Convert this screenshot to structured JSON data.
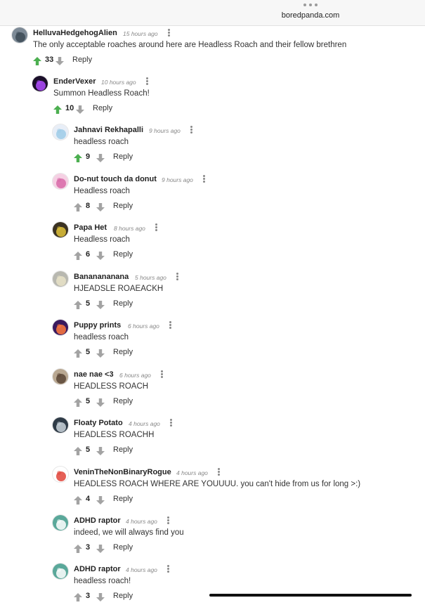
{
  "browser": {
    "url": "boredpanda.com"
  },
  "comments": [
    {
      "author": "HelluvaHedgehogAlien",
      "time": "15 hours ago",
      "text": "The only acceptable roaches around here are Headless Roach and their fellow brethren",
      "votes": "33",
      "voted": true,
      "reply": "Reply",
      "avatar_color": "#7d8a96",
      "avatar_accent": "#3c4a56"
    },
    {
      "author": "EnderVexer",
      "time": "10 hours ago",
      "text": "Summon Headless Roach!",
      "votes": "10",
      "voted": true,
      "reply": "Reply",
      "avatar_color": "#1b0f2a",
      "avatar_accent": "#b04bff"
    },
    {
      "author": "Jahnavi Rekhapalli",
      "time": "9 hours ago",
      "text": "headless roach",
      "votes": "9",
      "voted": true,
      "reply": "Reply",
      "avatar_color": "#e8eef7",
      "avatar_accent": "#9ecbe8"
    },
    {
      "author": "Do-nut touch da donut",
      "time": "9 hours ago",
      "text": "Headless roach",
      "votes": "8",
      "voted": false,
      "reply": "Reply",
      "avatar_color": "#f5d0e3",
      "avatar_accent": "#d86aa8"
    },
    {
      "author": "Papa Het",
      "time": "8 hours ago",
      "text": "Headless roach",
      "votes": "6",
      "voted": false,
      "reply": "Reply",
      "avatar_color": "#3b3222",
      "avatar_accent": "#e0c23a"
    },
    {
      "author": "Bananananana",
      "time": "5 hours ago",
      "text": "HJEADSLE ROAEACKH",
      "votes": "5",
      "voted": false,
      "reply": "Reply",
      "avatar_color": "#b8b8b0",
      "avatar_accent": "#e8e2c8"
    },
    {
      "author": "Puppy prints",
      "time": "6 hours ago",
      "text": "headless roach",
      "votes": "5",
      "voted": false,
      "reply": "Reply",
      "avatar_color": "#3a1a5e",
      "avatar_accent": "#ff7a3d"
    },
    {
      "author": "nae nae <3",
      "time": "6 hours ago",
      "text": "HEADLESS ROACH",
      "votes": "5",
      "voted": false,
      "reply": "Reply",
      "avatar_color": "#b9a892",
      "avatar_accent": "#5b4636"
    },
    {
      "author": "Floaty Potato",
      "time": "4 hours ago",
      "text": "HEADLESS ROACHH",
      "votes": "5",
      "voted": false,
      "reply": "Reply",
      "avatar_color": "#2f3b47",
      "avatar_accent": "#c9d3db"
    },
    {
      "author": "VeninTheNonBinaryRogue",
      "time": "4 hours ago",
      "text": "HEADLESS ROACH WHERE ARE YOUUUU. you can't hide from us for long >:)",
      "votes": "4",
      "voted": false,
      "reply": "Reply",
      "avatar_color": "#ffffff",
      "avatar_accent": "#e0443a"
    },
    {
      "author": "ADHD raptor",
      "time": "4 hours ago",
      "text": "indeed, we will always find you",
      "votes": "3",
      "voted": false,
      "reply": "Reply",
      "avatar_color": "#5aa89a",
      "avatar_accent": "#ffffff"
    },
    {
      "author": "ADHD raptor",
      "time": "4 hours ago",
      "text": "headless roach!",
      "votes": "3",
      "voted": false,
      "reply": "Reply",
      "avatar_color": "#5aa89a",
      "avatar_accent": "#ffffff"
    }
  ],
  "colors": {
    "upvote_active": "#4caf50",
    "vote_idle": "#a3a3a3"
  }
}
